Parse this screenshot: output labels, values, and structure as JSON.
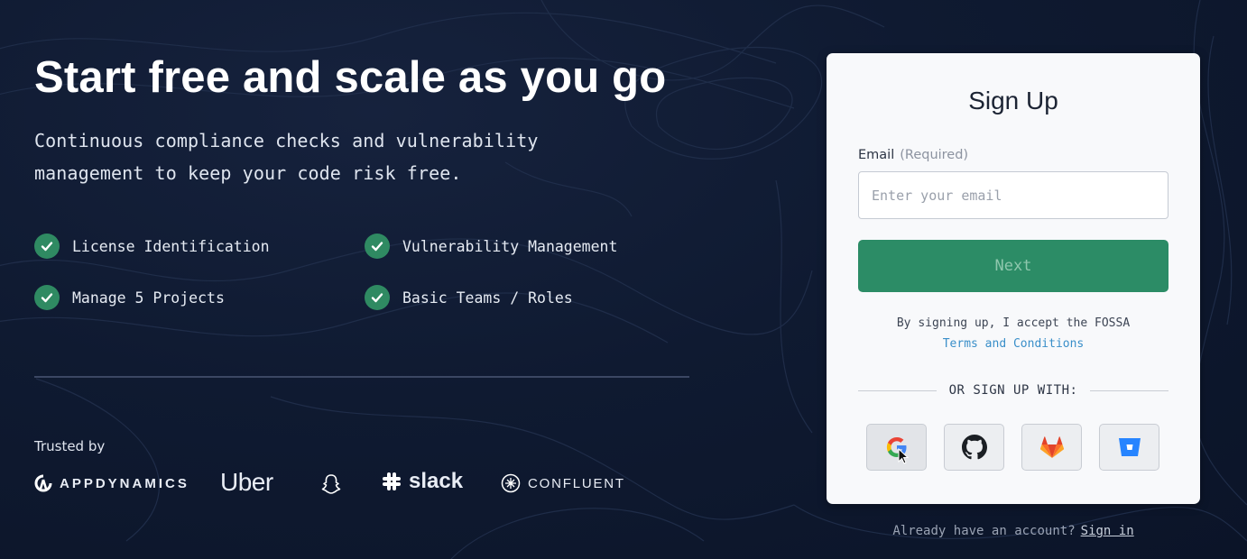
{
  "hero": {
    "title": "Start free and scale as you go",
    "subtitle_line1": "Continuous compliance checks and vulnerability",
    "subtitle_line2": "management to keep your code risk free."
  },
  "features": [
    {
      "label": "License Identification",
      "icon": "check-icon"
    },
    {
      "label": "Vulnerability Management",
      "icon": "check-icon"
    },
    {
      "label": "Manage 5 Projects",
      "icon": "check-icon"
    },
    {
      "label": "Basic Teams / Roles",
      "icon": "check-icon"
    }
  ],
  "trusted": {
    "label": "Trusted by",
    "logos": {
      "appdynamics": "APPDYNAMICS",
      "uber": "Uber",
      "snapchat": "snapchat-ghost",
      "slack": "slack",
      "confluent": "CONFLUENT"
    }
  },
  "signup": {
    "title": "Sign Up",
    "email_label": "Email",
    "email_required": "(Required)",
    "email_placeholder": "Enter your email",
    "email_value": "",
    "next_label": "Next",
    "terms_text": "By signing up, I accept the FOSSA",
    "terms_link": "Terms and Conditions",
    "or_text": "OR SIGN UP WITH:",
    "providers": [
      "google",
      "github",
      "gitlab",
      "bitbucket"
    ]
  },
  "footer": {
    "account_text": "Already have an account?",
    "sign_in": "Sign in"
  },
  "colors": {
    "background": "#0f1a31",
    "accent": "#2c8c66",
    "link": "#3a8fc9",
    "card": "#f8f9fb"
  }
}
